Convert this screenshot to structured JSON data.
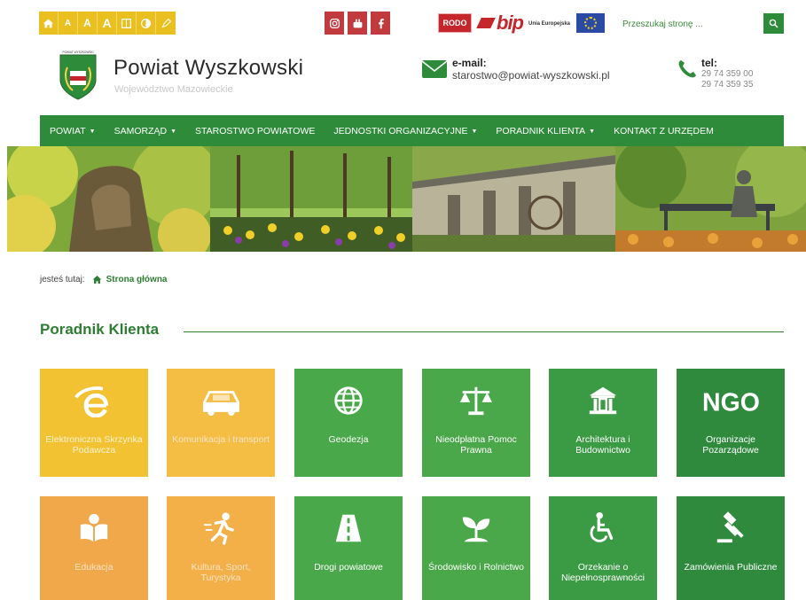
{
  "accessibility": {
    "items": [
      "",
      "A",
      "A",
      "A",
      "",
      "",
      ""
    ],
    "icons": [
      "home-icon",
      "font-size-a-small",
      "font-size-a-medium",
      "font-size-a-large",
      "grid-icon",
      "contrast-icon",
      "pen-icon"
    ]
  },
  "social": {
    "icons": [
      "instagram-icon",
      "youtube-icon",
      "facebook-icon"
    ]
  },
  "badges": {
    "rodo": "RODO",
    "bip": "bip",
    "eu": "Unia Europejska"
  },
  "search": {
    "placeholder": "Przeszukaj stronę ..."
  },
  "header": {
    "title": "Powiat Wyszkowski",
    "subtitle": "Województwo Mazowieckie",
    "crest_text": "POWIAT WYSZKOWSKI",
    "email_label": "e-mail:",
    "email": "starostwo@powiat-wyszkowski.pl",
    "tel_label": "tel:",
    "tel_1": "29 74 359 00",
    "tel_2": "29 74 359 35"
  },
  "nav": [
    {
      "label": "POWIAT",
      "dropdown": true
    },
    {
      "label": "SAMORZĄD",
      "dropdown": true
    },
    {
      "label": "STAROSTWO POWIATOWE",
      "dropdown": false
    },
    {
      "label": "JEDNOSTKI ORGANIZACYJNE",
      "dropdown": true
    },
    {
      "label": "PORADNIK KLIENTA",
      "dropdown": true
    },
    {
      "label": "KONTAKT Z URZĘDEM",
      "dropdown": false
    }
  ],
  "breadcrumb": {
    "prefix": "jesteś tutaj:",
    "current": "Strona główna"
  },
  "section": {
    "title": "Poradnik Klienta"
  },
  "tiles": [
    {
      "label": "Elektroniczna Skrzynka Podawcza",
      "icon": "e-icon"
    },
    {
      "label": "Komunikacja i transport",
      "icon": "car-icon"
    },
    {
      "label": "Geodezja",
      "icon": "globe-icon"
    },
    {
      "label": "Nieodpłatna Pomoc Prawna",
      "icon": "scales-icon"
    },
    {
      "label": "Architektura i Budownictwo",
      "icon": "building-icon"
    },
    {
      "label": "Organizacje Pozarządowe",
      "icon": "ngo-icon",
      "icon_text": "NGO"
    },
    {
      "label": "Edukacja",
      "icon": "book-reader-icon"
    },
    {
      "label": "Kultura, Sport, Turystyka",
      "icon": "runner-icon"
    },
    {
      "label": "Drogi powiatowe",
      "icon": "road-icon"
    },
    {
      "label": "Środowisko i Rolnictwo",
      "icon": "seedling-icon"
    },
    {
      "label": "Orzekanie o Niepełnosprawności",
      "icon": "wheelchair-icon"
    },
    {
      "label": "Zamówienia Publiczne",
      "icon": "gavel-icon"
    }
  ],
  "colors": {
    "accent_green": "#2e8b3a",
    "accessibility_yellow": "#e9c020",
    "social_red": "#c03a3e",
    "tile_yellow": "#f2c232",
    "tile_orange": "#f0a84a",
    "tile_green": "#49a84a",
    "tile_dark_green": "#2f8a3e"
  }
}
